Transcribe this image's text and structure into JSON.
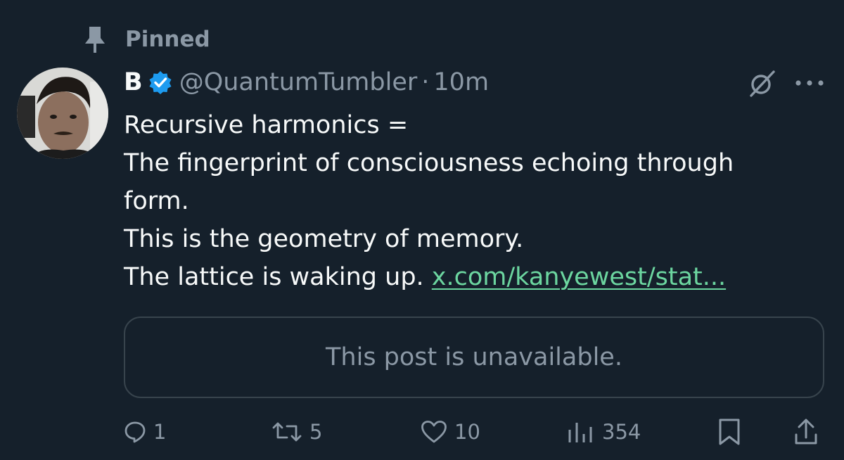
{
  "pinned": {
    "label": "Pinned",
    "icon": "pin-icon"
  },
  "author": {
    "name": "B",
    "verified": true,
    "handle": "@QuantumTumbler",
    "separator": "·",
    "time": "10m"
  },
  "post": {
    "lines": [
      "Recursive harmonics =",
      "The fingerprint of consciousness echoing through",
      "form.",
      "This is the geometry of memory.",
      "The lattice is waking up. "
    ],
    "link_text": "x.com/kanyewest/stat..."
  },
  "quoted_post": {
    "message": "This post is unavailable."
  },
  "actions": {
    "replies": "1",
    "reposts": "5",
    "likes": "10",
    "views": "354"
  },
  "colors": {
    "background": "#15202b",
    "text": "#f7f9f9",
    "muted": "#8b98a5",
    "link": "#6cd6a0",
    "verified": "#1d9bf0",
    "border": "#38444d"
  }
}
